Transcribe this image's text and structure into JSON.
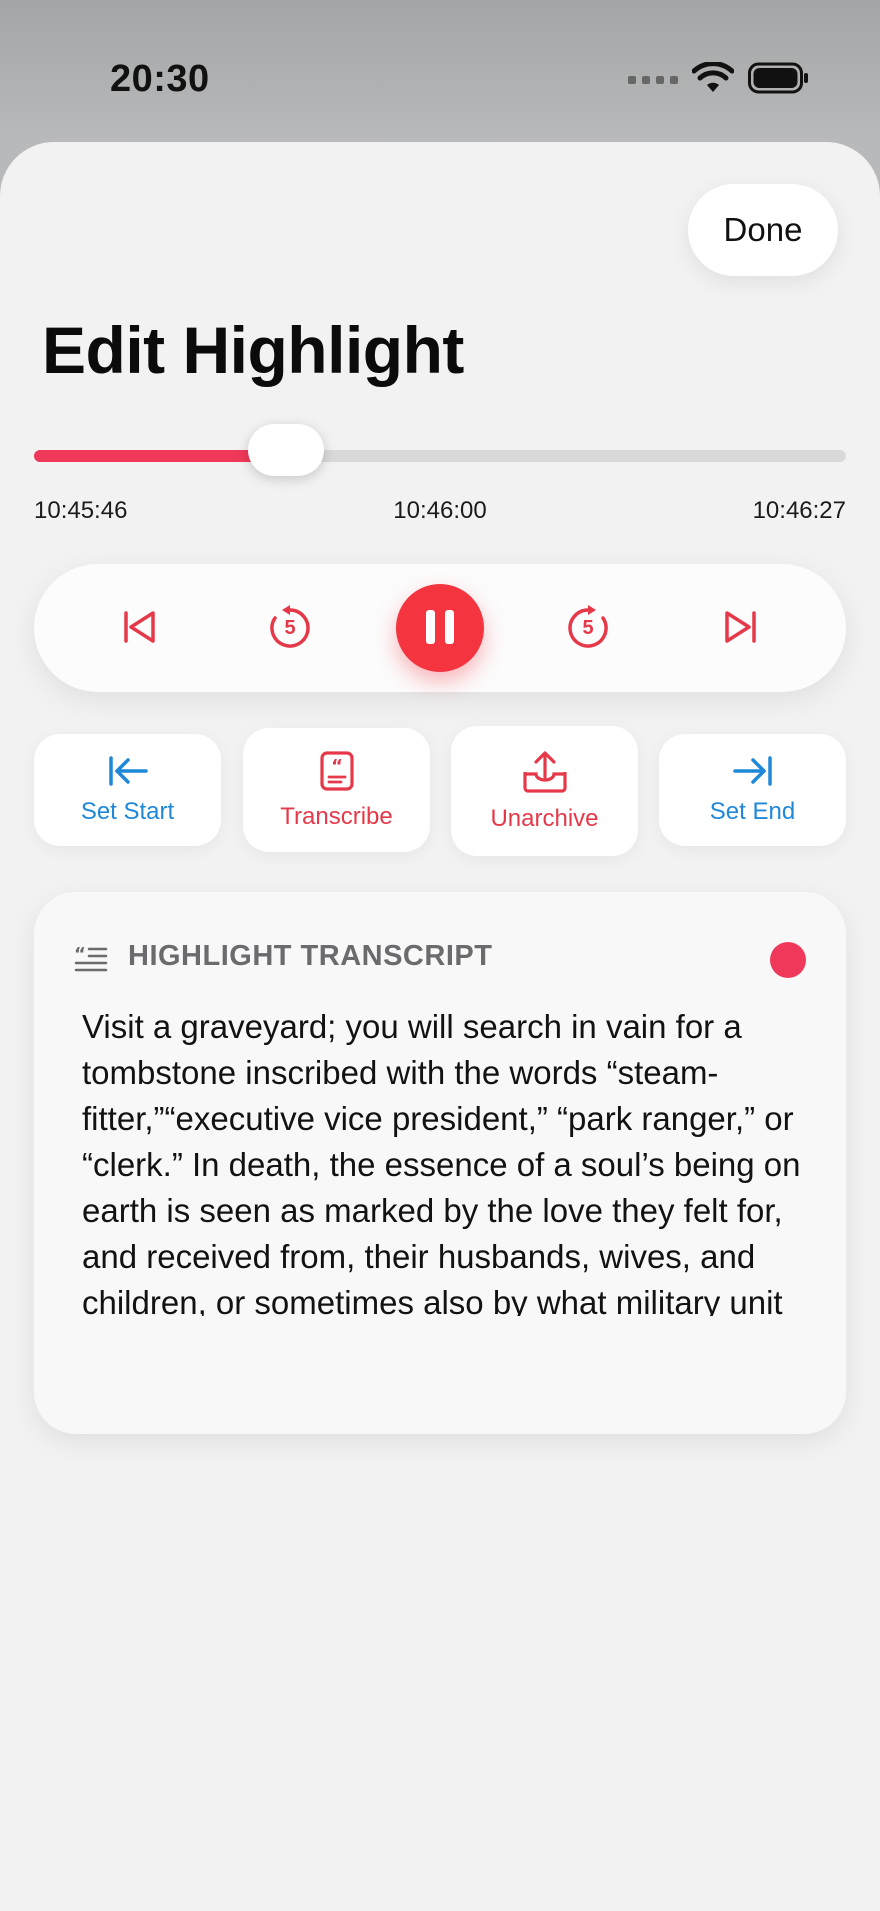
{
  "status_bar": {
    "time": "20:30",
    "icons": [
      "signal-dots-icon",
      "wifi-icon",
      "battery-icon"
    ]
  },
  "sheet": {
    "done_label": "Done",
    "title": "Edit Highlight"
  },
  "scrubber": {
    "start_time": "10:45:46",
    "current_time": "10:46:00",
    "end_time": "10:46:27",
    "progress": 0.31,
    "accent_color": "#f0395a"
  },
  "transport": {
    "buttons": [
      "skip-to-start-icon",
      "rewind-5-icon",
      "pause-icon",
      "forward-5-icon",
      "skip-to-end-icon"
    ],
    "rewind_seconds": "5",
    "forward_seconds": "5"
  },
  "actions": {
    "set_start": "Set Start",
    "transcribe": "Transcribe",
    "unarchive": "Unarchive",
    "set_end": "Set End"
  },
  "transcript_card": {
    "title": "HIGHLIGHT TRANSCRIPT",
    "text": "Visit a graveyard; you will search in vain for a tombstone inscribed with the words “steam-fitter,”“executive vice president,” “park ranger,” or “clerk.” In death, the essence of a soul’s being on earth is seen as marked by the love they felt for, and received from, their husbands, wives, and children, or sometimes also by what military unit they served with in time of war. These are all things which"
  },
  "colors": {
    "accent_red": "#f4343f",
    "accent_blue": "#1f88d9"
  }
}
